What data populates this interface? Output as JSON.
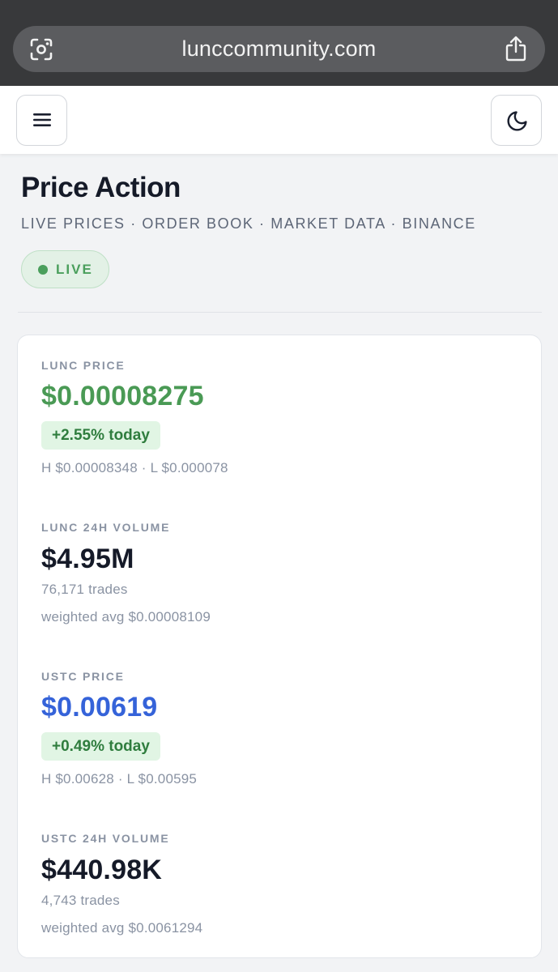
{
  "browser": {
    "url": "lunccommunity.com",
    "left_icon": "visual-lookup-icon",
    "right_icon": "share-icon"
  },
  "header": {
    "menu_icon": "hamburger-icon",
    "theme_icon": "moon-icon"
  },
  "page": {
    "title": "Price Action",
    "subtitle": "LIVE PRICES · ORDER BOOK · MARKET DATA · BINANCE",
    "live_label": "LIVE"
  },
  "stats": {
    "lunc_price": {
      "label": "LUNC PRICE",
      "value": "$0.00008275",
      "change": "+2.55% today",
      "range": "H $0.00008348 · L $0.000078"
    },
    "lunc_volume": {
      "label": "LUNC 24H VOLUME",
      "value": "$4.95M",
      "trades": "76,171 trades",
      "weighted": "weighted avg $0.00008109"
    },
    "ustc_price": {
      "label": "USTC PRICE",
      "value": "$0.00619",
      "change": "+0.49% today",
      "range": "H $0.00628 · L $0.00595"
    },
    "ustc_volume": {
      "label": "USTC 24H VOLUME",
      "value": "$440.98K",
      "trades": "4,743 trades",
      "weighted": "weighted avg $0.0061294"
    }
  },
  "colors": {
    "positive": "#4a9a55",
    "ustc_accent": "#3563d9",
    "live_green": "#4a9f5c",
    "change_bg": "#e1f5e4"
  }
}
